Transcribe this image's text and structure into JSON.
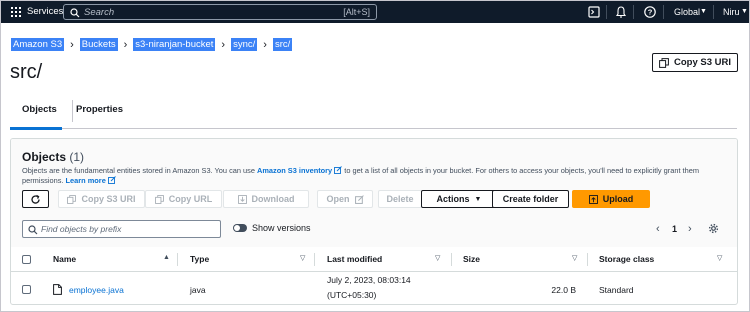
{
  "topnav": {
    "services_label": "Services",
    "search_placeholder": "Search",
    "search_shortcut": "[Alt+S]",
    "region_label": "Global",
    "user_label": "Niru"
  },
  "breadcrumbs": [
    "Amazon S3",
    "Buckets",
    "s3-niranjan-bucket",
    "sync/",
    "src/"
  ],
  "page": {
    "title": "src/",
    "copy_s3_uri_label": "Copy S3 URI"
  },
  "tabs": [
    "Objects",
    "Properties"
  ],
  "objects_panel": {
    "title": "Objects",
    "count": "(1)",
    "description_part1": "Objects are the fundamental entities stored in Amazon S3. You can use ",
    "description_link": "Amazon S3 inventory",
    "description_part2": " to get a list of all objects in your bucket. For others to access your objects, you'll need to explicitly grant them permissions.",
    "learn_more": "Learn more",
    "buttons": {
      "copy_s3_uri": "Copy S3 URI",
      "copy_url": "Copy URL",
      "download": "Download",
      "open": "Open",
      "delete": "Delete",
      "actions": "Actions",
      "create_folder": "Create folder",
      "upload": "Upload"
    },
    "filter_placeholder": "Find objects by prefix",
    "show_versions_label": "Show versions",
    "page_number": "1"
  },
  "table": {
    "columns": [
      "Name",
      "Type",
      "Last modified",
      "Size",
      "Storage class"
    ],
    "rows": [
      {
        "name": "employee.java",
        "type": "java",
        "last_modified_line1": "July 2, 2023, 08:03:14",
        "last_modified_line2": "(UTC+05:30)",
        "size": "22.0 B",
        "storage_class": "Standard"
      }
    ]
  },
  "colors": {
    "nav_bg": "#0f1b2a",
    "link": "#0972d3",
    "primary_button": "#ff9900",
    "breadcrumb_highlight": "#3b82f6"
  }
}
